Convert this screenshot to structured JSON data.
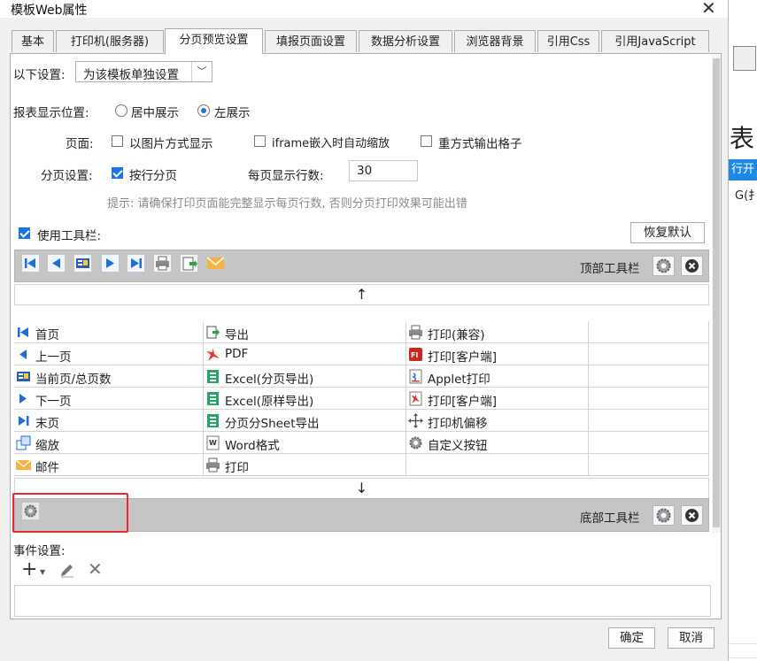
{
  "window": {
    "title": "模板Web属性"
  },
  "tabs": [
    {
      "label": "基本"
    },
    {
      "label": "打印机(服务器)"
    },
    {
      "label": "分页预览设置"
    },
    {
      "label": "填报页面设置"
    },
    {
      "label": "数据分析设置"
    },
    {
      "label": "浏览器背景"
    },
    {
      "label": "引用Css"
    },
    {
      "label": "引用JavaScript"
    }
  ],
  "settings": {
    "scope_label": "以下设置:",
    "scope_value": "为该模板单独设置",
    "position_label": "报表显示位置:",
    "position_center": "居中展示",
    "position_left": "左展示",
    "page_label": "页面:",
    "opt_image": "以图片方式显示",
    "opt_iframe": "iframe嵌入时自动缩放",
    "opt_repeat": "重方式输出格子",
    "paging_label": "分页设置:",
    "paging_row": "按行分页",
    "rows_label": "每页显示行数:",
    "rows_value": "30",
    "hint": "提示: 请确保打印页面能完整显示每页行数, 否则分页打印效果可能出错"
  },
  "toolbar_section": {
    "use_toolbar": "使用工具栏:",
    "restore_default": "恢复默认",
    "top_toolbar": "顶部工具栏",
    "bottom_toolbar": "底部工具栏",
    "up_arrow": "↑",
    "down_arrow": "↓"
  },
  "buttons": [
    [
      "首页",
      "导出",
      "打印(兼容)"
    ],
    [
      "上一页",
      "PDF",
      "打印[客户端]"
    ],
    [
      "当前页/总页数",
      "Excel(分页导出)",
      "Applet打印"
    ],
    [
      "下一页",
      "Excel(原样导出)",
      "打印[客户端]"
    ],
    [
      "末页",
      "分页分Sheet导出",
      "打印机偏移"
    ],
    [
      "缩放",
      "Word格式",
      "自定义按钮"
    ],
    [
      "邮件",
      "打印",
      ""
    ]
  ],
  "events": {
    "label": "事件设置:"
  },
  "footer": {
    "ok": "确定",
    "cancel": "取消"
  },
  "background": {
    "big_char": "表",
    "blue_strip": "行开",
    "g_text": "G(扌"
  },
  "colors": {
    "accent": "#1a73e8",
    "toolbar_gray": "#c5c5c5",
    "highlight_red": "#e62b2b"
  }
}
